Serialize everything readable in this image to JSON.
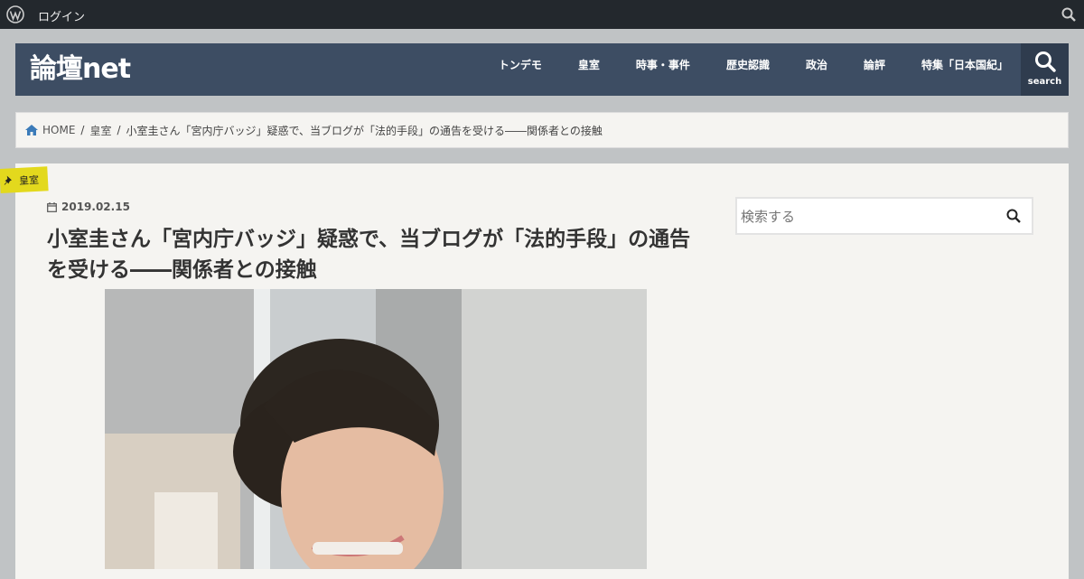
{
  "adminbar": {
    "login_label": "ログイン"
  },
  "header": {
    "logo": "論壇net",
    "nav": [
      "トンデモ",
      "皇室",
      "時事・事件",
      "歴史認識",
      "政治",
      "論評",
      "特集「日本国紀」"
    ],
    "search_label": "search"
  },
  "breadcrumb": {
    "home": "HOME",
    "category": "皇室",
    "current": "小室圭さん「宮内庁バッジ」疑惑で、当ブログが「法的手段」の通告を受ける――関係者との接触"
  },
  "post": {
    "category": "皇室",
    "date": "2019.02.15",
    "title": "小室圭さん「宮内庁バッジ」疑惑で、当ブログが「法的手段」の通告を受ける――関係者との接触"
  },
  "sidebar": {
    "search_placeholder": "検索する"
  },
  "colors": {
    "header_bg": "#3d4d63",
    "admin_bg": "#23282d",
    "badge": "#e3d91d",
    "page_bg": "#c0c3c5"
  }
}
